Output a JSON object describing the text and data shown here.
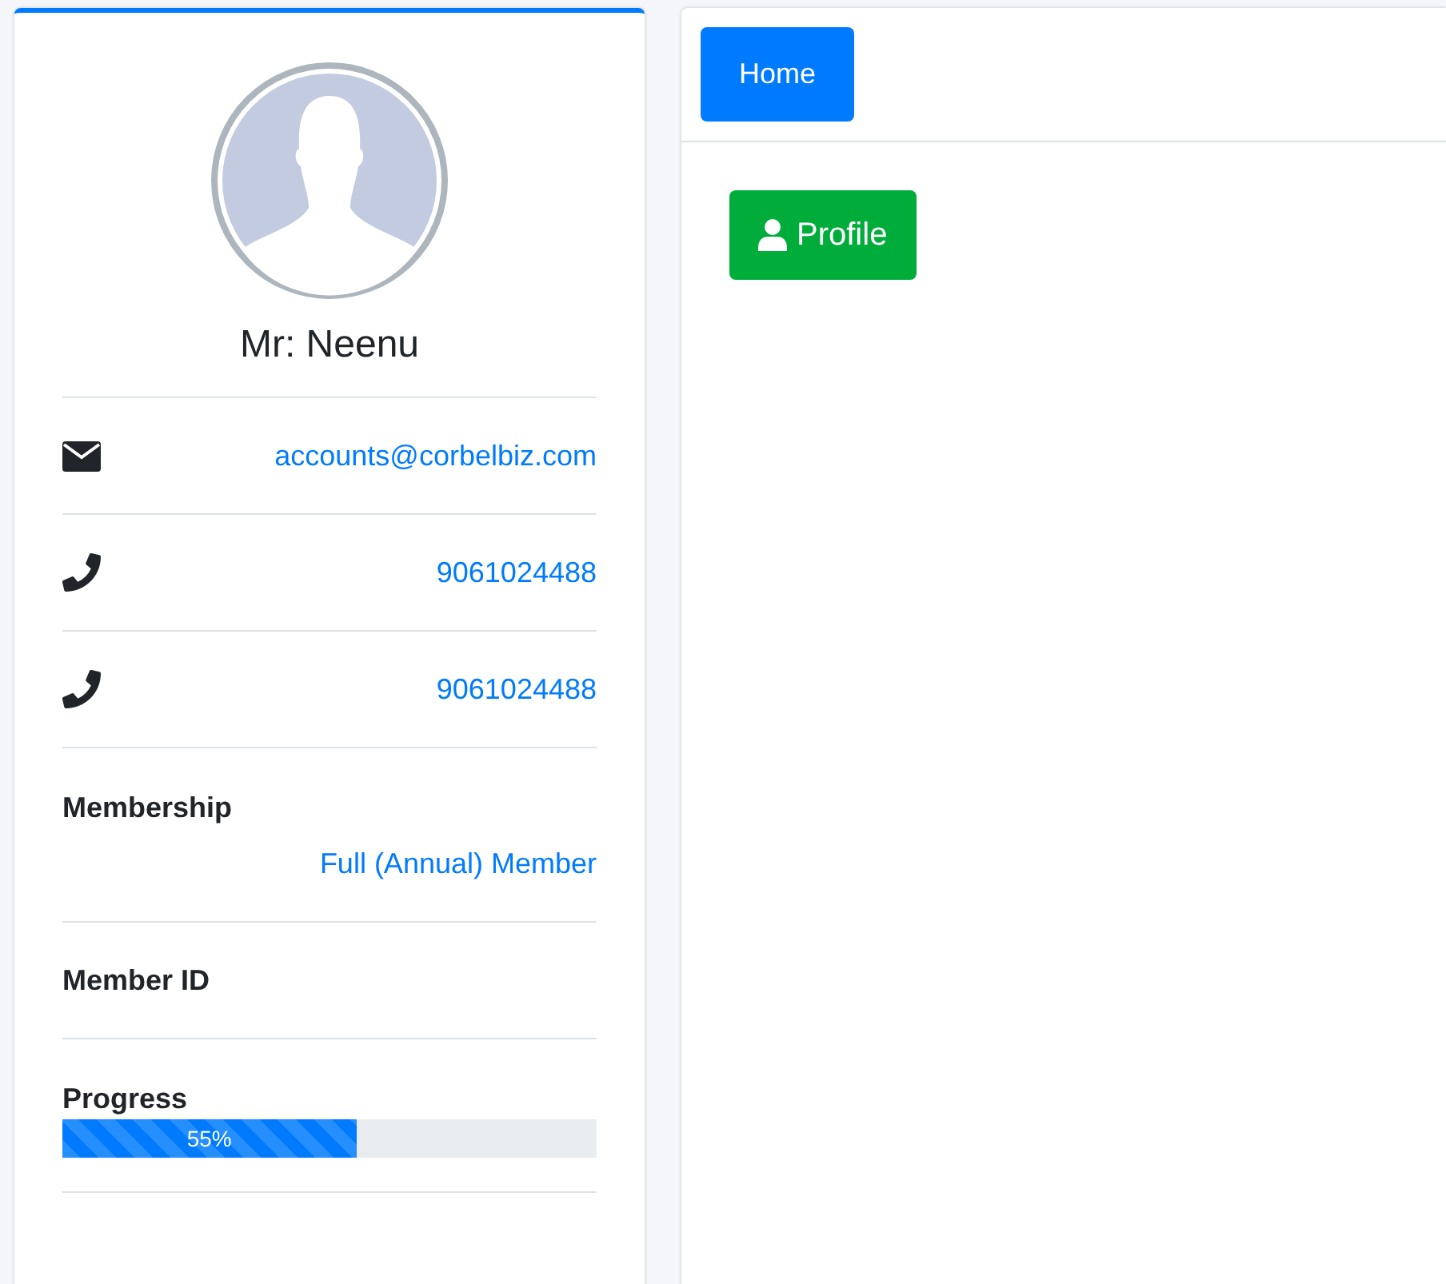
{
  "profile": {
    "name": "Mr: Neenu"
  },
  "contacts": [
    {
      "kind": "email",
      "value": "accounts@corbelbiz.com"
    },
    {
      "kind": "phone",
      "value": "9061024488"
    },
    {
      "kind": "phone",
      "value": "9061024488"
    }
  ],
  "membership": {
    "label": "Membership",
    "value": "Full (Annual) Member"
  },
  "member_id": {
    "label": "Member ID"
  },
  "progress": {
    "label": "Progress",
    "level": 0.55,
    "reading": "55%"
  },
  "nav": [
    {
      "label": "Home",
      "selected": true
    }
  ],
  "actions": [
    {
      "label": "Profile",
      "kind": "profile"
    }
  ]
}
